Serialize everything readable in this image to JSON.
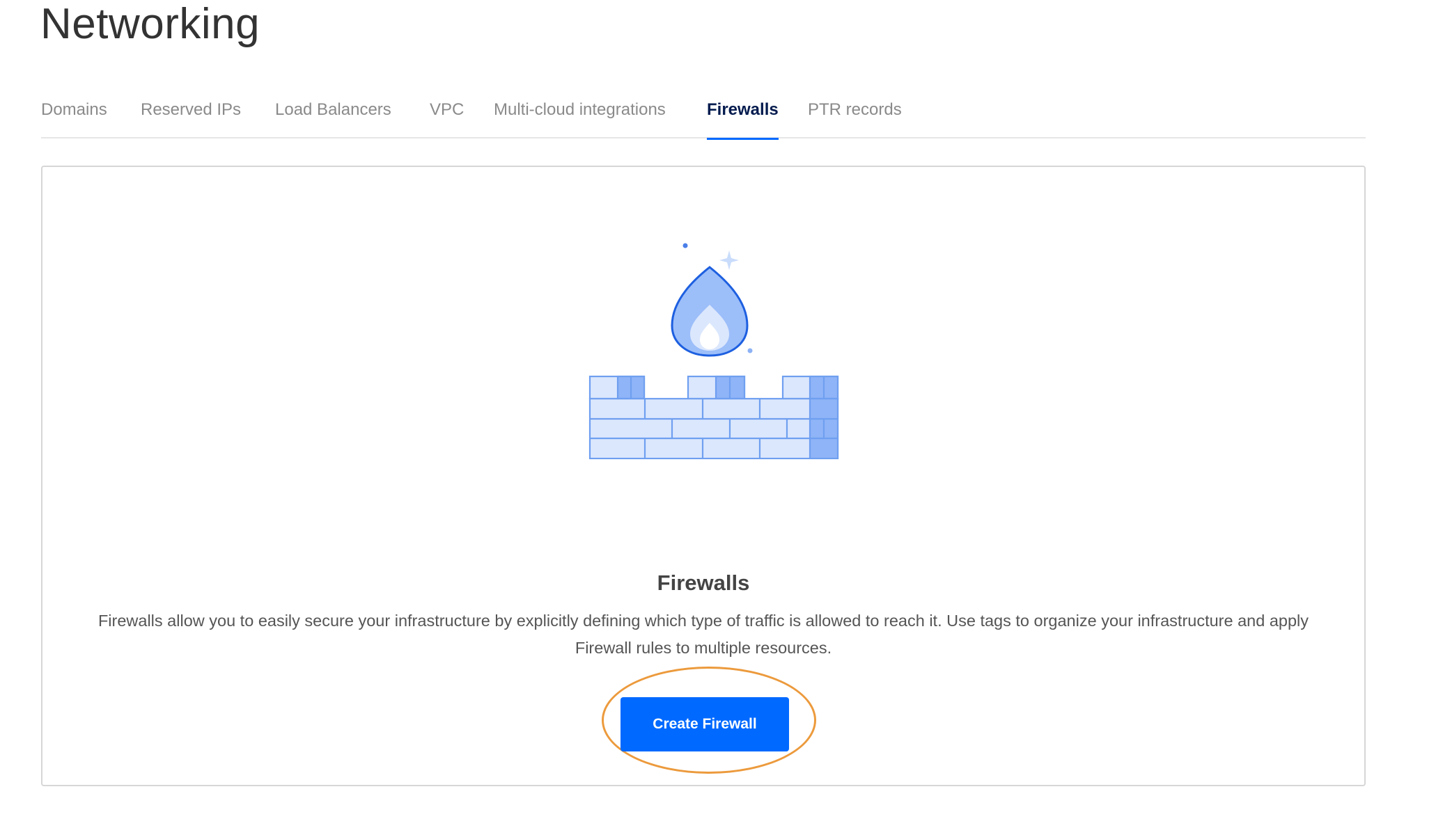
{
  "header": {
    "title": "Networking"
  },
  "tabs": [
    {
      "label": "Domains",
      "active": false
    },
    {
      "label": "Reserved IPs",
      "active": false
    },
    {
      "label": "Load Balancers",
      "active": false
    },
    {
      "label": "VPC",
      "active": false
    },
    {
      "label": "Multi-cloud integrations",
      "active": false
    },
    {
      "label": "Firewalls",
      "active": true
    },
    {
      "label": "PTR records",
      "active": false
    }
  ],
  "empty_state": {
    "illustration_icon": "firewall-brick-wall-flame-icon",
    "title": "Firewalls",
    "description": "Firewalls allow you to easily secure your infrastructure by explicitly defining which type of traffic is allowed to reach it. Use tags to organize your infrastructure and apply Firewall rules to multiple resources.",
    "cta_label": "Create Firewall"
  },
  "colors": {
    "accent": "#0069ff",
    "active_tab_text": "#031b4e",
    "highlight_ring": "#ec9a3c"
  }
}
